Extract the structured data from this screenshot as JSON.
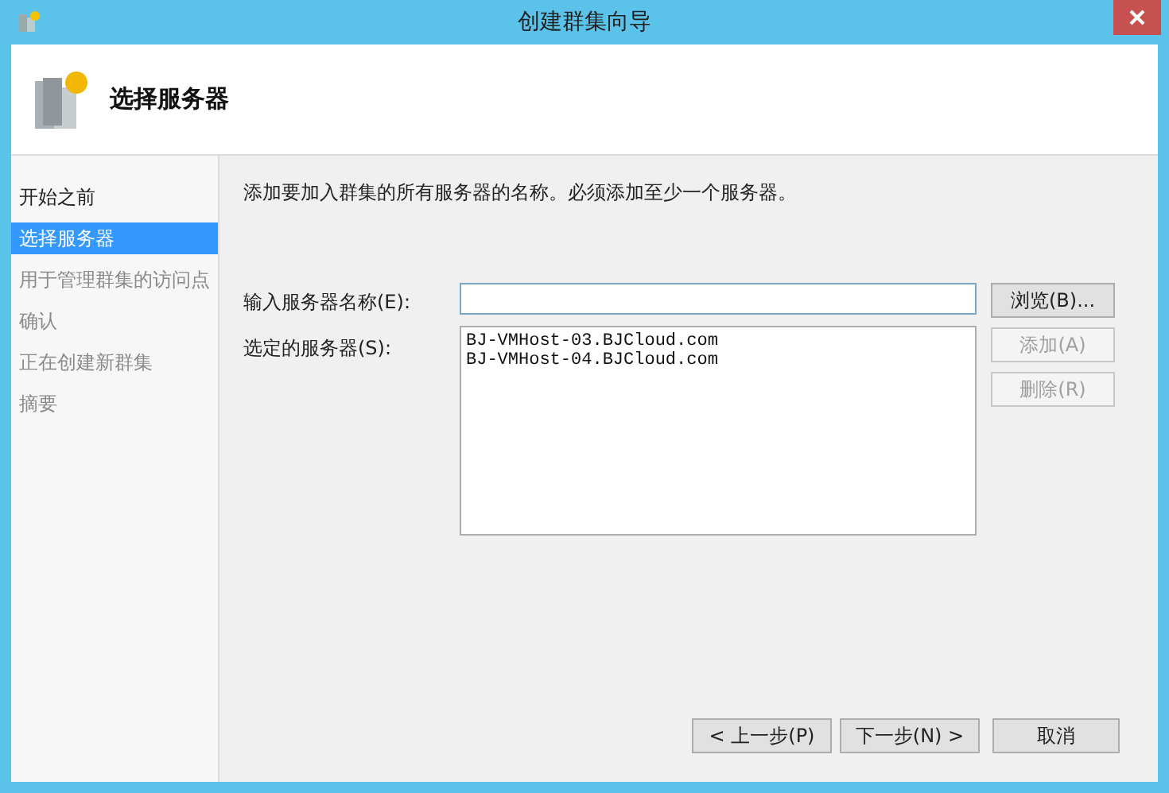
{
  "window": {
    "title": "创建群集向导"
  },
  "header": {
    "title": "选择服务器"
  },
  "steps": [
    {
      "label": "开始之前",
      "selected": false
    },
    {
      "label": "选择服务器",
      "selected": true
    },
    {
      "label": "用于管理群集的访问点",
      "selected": false
    },
    {
      "label": "确认",
      "selected": false
    },
    {
      "label": "正在创建新群集",
      "selected": false
    },
    {
      "label": "摘要",
      "selected": false
    }
  ],
  "description": "添加要加入群集的所有服务器的名称。必须添加至少一个服务器。",
  "server_name": {
    "label": "输入服务器名称(E):"
  },
  "selected_servers": {
    "label": "选定的服务器(S):",
    "items": [
      "BJ-VMHost-03.BJCloud.com",
      "BJ-VMHost-04.BJCloud.com"
    ]
  },
  "side_buttons": [
    {
      "label": "浏览(B)...",
      "disabled": false
    },
    {
      "label": "添加(A)",
      "disabled": true
    },
    {
      "label": "删除(R)",
      "disabled": true
    }
  ],
  "footer_buttons": [
    {
      "label": "< 上一步(P)",
      "disabled": false
    },
    {
      "label": "下一步(N) >",
      "disabled": false
    },
    {
      "label": "取消",
      "disabled": false
    }
  ]
}
